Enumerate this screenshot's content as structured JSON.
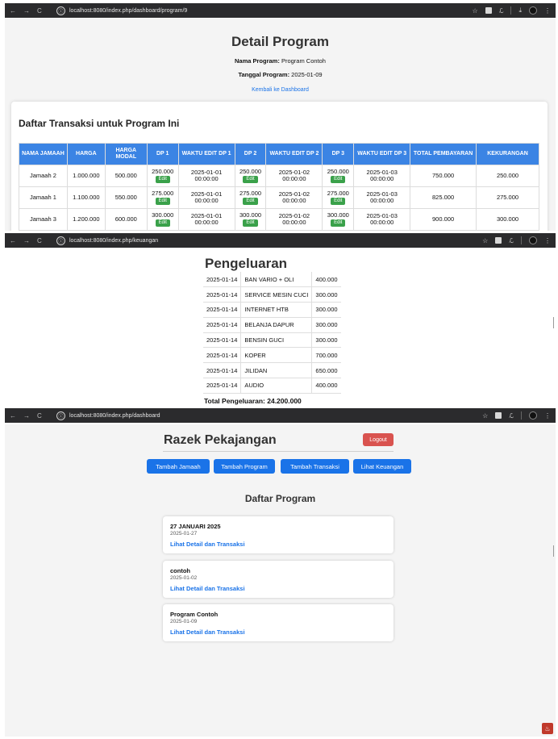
{
  "windows": [
    {
      "url": "localhost:8080/index.php/dashboard/program/9"
    },
    {
      "url": "localhost:8080/index.php/keuangan"
    },
    {
      "url": "localhost:8080/index.php/dashboard"
    }
  ],
  "chrome_icons": {
    "back": "←",
    "forward": "→",
    "reload": "C",
    "star": "☆",
    "download": "⤓",
    "menu": "⋮",
    "info": "ⓘ"
  },
  "detail": {
    "title": "Detail Program",
    "nama_label": "Nama Program:",
    "nama_value": "Program Contoh",
    "tanggal_label": "Tanggal Program:",
    "tanggal_value": "2025-01-09",
    "back_link": "Kembali ke Dashboard",
    "table_title": "Daftar Transaksi untuk Program Ini",
    "edit_label": "Edit",
    "headers": [
      "NAMA JAMAAH",
      "HARGA",
      "HARGA MODAL",
      "DP 1",
      "WAKTU EDIT DP 1",
      "DP 2",
      "WAKTU EDIT DP 2",
      "DP 3",
      "WAKTU EDIT DP 3",
      "TOTAL PEMBAYARAN",
      "KEKURANGAN"
    ],
    "rows": [
      {
        "nama": "Jamaah 2",
        "harga": "1.000.000",
        "modal": "500.000",
        "dp1": "250.000",
        "w1a": "2025-01-01",
        "w1b": "00:00:00",
        "dp2": "250.000",
        "w2a": "2025-01-02",
        "w2b": "00:00:00",
        "dp3": "250.000",
        "w3a": "2025-01-03",
        "w3b": "00:00:00",
        "total": "750.000",
        "kurang": "250.000"
      },
      {
        "nama": "Jamaah 1",
        "harga": "1.100.000",
        "modal": "550.000",
        "dp1": "275.000",
        "w1a": "2025-01-01",
        "w1b": "00:00:00",
        "dp2": "275.000",
        "w2a": "2025-01-02",
        "w2b": "00:00:00",
        "dp3": "275.000",
        "w3a": "2025-01-03",
        "w3b": "00:00:00",
        "total": "825.000",
        "kurang": "275.000"
      },
      {
        "nama": "Jamaah 3",
        "harga": "1.200.000",
        "modal": "600.000",
        "dp1": "300.000",
        "w1a": "2025-01-01",
        "w1b": "00:00:00",
        "dp2": "300.000",
        "w2a": "2025-01-02",
        "w2b": "00:00:00",
        "dp3": "300.000",
        "w3a": "2025-01-03",
        "w3b": "00:00:00",
        "total": "900.000",
        "kurang": "300.000"
      }
    ]
  },
  "keuangan": {
    "title": "Pengeluaran",
    "rows": [
      {
        "date": "2025-01-14",
        "desc": "BAN VARIO + OLI",
        "amount": "400.000"
      },
      {
        "date": "2025-01-14",
        "desc": "SERVICE MESIN CUCI",
        "amount": "300.000"
      },
      {
        "date": "2025-01-14",
        "desc": "INTERNET HTB",
        "amount": "300.000"
      },
      {
        "date": "2025-01-14",
        "desc": "BELANJA DAPUR",
        "amount": "300.000"
      },
      {
        "date": "2025-01-14",
        "desc": "BENSIN GUCI",
        "amount": "300.000"
      },
      {
        "date": "2025-01-14",
        "desc": "KOPER",
        "amount": "700.000"
      },
      {
        "date": "2025-01-14",
        "desc": "JILIDAN",
        "amount": "650.000"
      },
      {
        "date": "2025-01-14",
        "desc": "AUDIO",
        "amount": "400.000"
      }
    ],
    "total": "Total Pengeluaran: 24.200.000"
  },
  "dashboard": {
    "brand": "Razek Pekajangan",
    "logout": "Logout",
    "buttons": [
      "Tambah Jamaah",
      "Tambah Program",
      "Tambah Transaksi",
      "Lihat Keuangan"
    ],
    "section_title": "Daftar Program",
    "link_label": "Lihat Detail dan Transaksi",
    "programs": [
      {
        "name": "27 JANUARI 2025",
        "date": "2025-01-27"
      },
      {
        "name": "contoh",
        "date": "2025-01-02"
      },
      {
        "name": "Program Contoh",
        "date": "2025-01-09"
      }
    ]
  },
  "colors": {
    "primary": "#1a73e8",
    "table_header": "#3b84e4",
    "edit": "#3aa14a",
    "logout": "#d9534f"
  }
}
